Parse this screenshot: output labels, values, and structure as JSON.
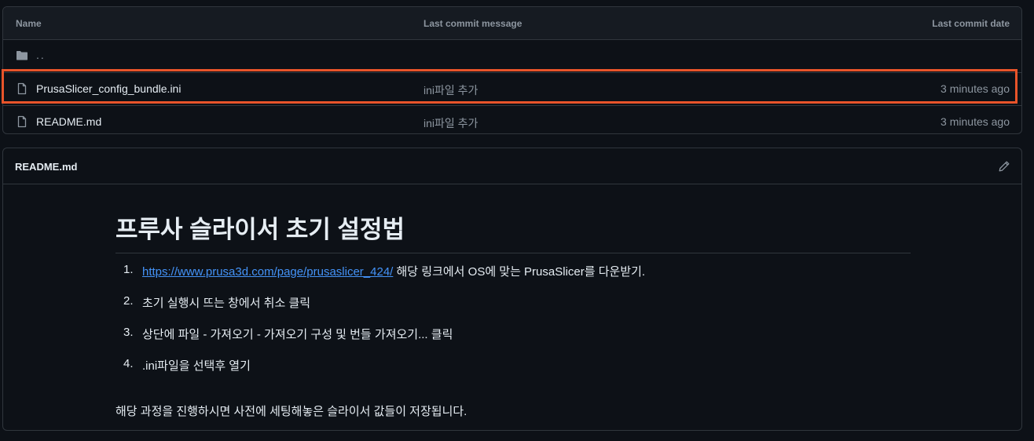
{
  "file_table": {
    "headers": {
      "name": "Name",
      "message": "Last commit message",
      "date": "Last commit date"
    },
    "parent": "..",
    "files": [
      {
        "name": "PrusaSlicer_config_bundle.ini",
        "message": "ini파일 추가",
        "date": "3 minutes ago",
        "icon": "file-icon"
      },
      {
        "name": "README.md",
        "message": "ini파일 추가",
        "date": "3 minutes ago",
        "icon": "file-icon"
      }
    ]
  },
  "readme": {
    "title": "README.md",
    "heading": "프루사 슬라이서 초기 설정법",
    "steps": [
      {
        "num": "1.",
        "link": "https://www.prusa3d.com/page/prusaslicer_424/",
        "text": " 해당 링크에서 OS에 맞는 PrusaSlicer를 다운받기."
      },
      {
        "num": "2.",
        "text": "초기 실행시 뜨는 창에서 취소 클릭"
      },
      {
        "num": "3.",
        "text": "상단에 파일 - 가져오기 - 가져오기 구성 및 번들 가져오기... 클릭"
      },
      {
        "num": "4.",
        "text": ".ini파일을 선택후 열기"
      }
    ],
    "paragraph": "해당 과정을 진행하시면 사전에 세팅해놓은 슬라이서 값들이 저장됩니다."
  },
  "colors": {
    "highlight": "#e8542a",
    "link": "#4493f8",
    "background": "#0d1117"
  }
}
